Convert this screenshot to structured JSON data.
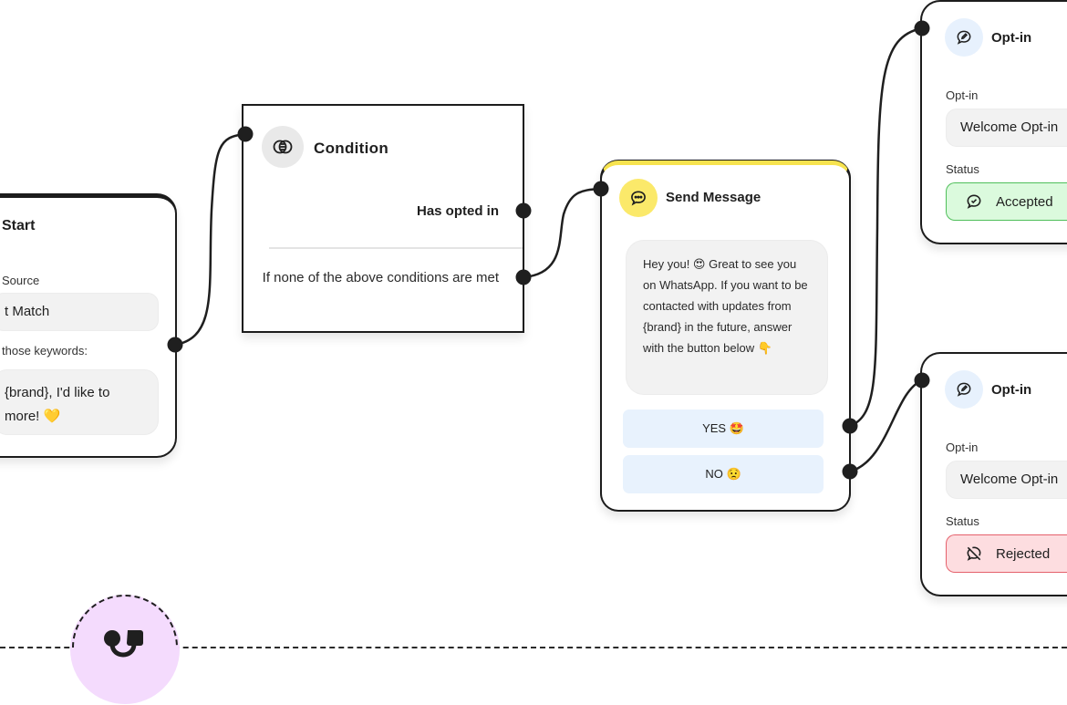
{
  "start_node": {
    "title": "Start",
    "source_label": "Source",
    "source_value": "t Match",
    "keywords_label": "those keywords:",
    "keywords_value": "{brand}, I'd like to more! 💛",
    "keywords_line1": "{brand}, I'd like to",
    "keywords_line2": "more! 💛"
  },
  "condition_node": {
    "title": "Condition",
    "icon": "intersect-circles-icon",
    "cases": [
      {
        "label": "Has opted in"
      },
      {
        "label": "If none of the above conditions are met"
      }
    ]
  },
  "send_message_node": {
    "title": "Send Message",
    "icon": "chat-bubble-icon",
    "accent_color": "#fbe96a",
    "message": "Hey you! 😍 Great to see you on WhatsApp. If you want to be contacted with updates from {brand} in the future, answer with the button below 👇",
    "buttons": [
      {
        "label": "YES 🤩"
      },
      {
        "label": "NO 😟"
      }
    ]
  },
  "optin_nodes": [
    {
      "title": "Opt-in",
      "icon": "chat-pencil-icon",
      "optin_label": "Opt-in",
      "optin_value": "Welcome Opt-in",
      "status_label": "Status",
      "status_value": "Accepted",
      "status_icon": "chat-check-icon",
      "status_color": "#4fbf5a"
    },
    {
      "title": "Opt-in",
      "icon": "chat-pencil-icon",
      "optin_label": "Opt-in",
      "optin_value": "Welcome Opt-in",
      "status_label": "Status",
      "status_value": "Rejected",
      "status_icon": "chat-slash-icon",
      "status_color": "#e5616c"
    }
  ],
  "brand_avatar": {
    "icon": "brand-logo-icon",
    "background_color": "#f4dbfd"
  }
}
